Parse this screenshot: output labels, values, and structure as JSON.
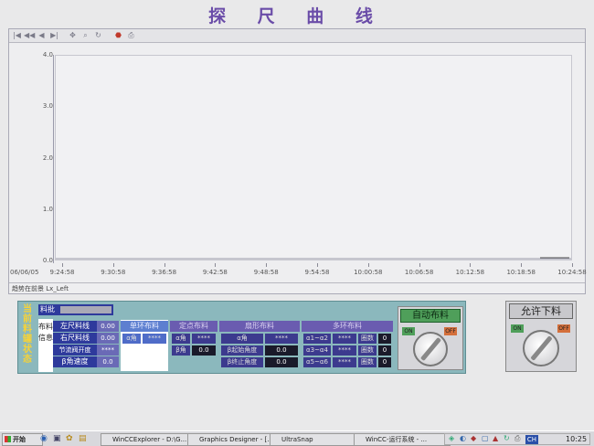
{
  "title": "探 尺 曲 线",
  "trend": {
    "toolbar_icons": [
      "first-icon",
      "prev-icon",
      "back-icon",
      "next-icon",
      "pan-icon",
      "zoom-icon",
      "refresh-icon",
      "stop-icon",
      "print-icon"
    ],
    "status_text": "趋势在前景 Lx_Left",
    "date_label": "06/06/05"
  },
  "chart_data": {
    "type": "line",
    "y_ticks": [
      "4.0",
      "3.0",
      "2.0",
      "1.0",
      "0.0"
    ],
    "ylim": [
      0,
      4
    ],
    "x_ticks": [
      "9:24:58",
      "9:30:58",
      "9:36:58",
      "9:42:58",
      "9:48:58",
      "9:54:58",
      "10:00:58",
      "10:06:58",
      "10:12:58",
      "10:18:58",
      "10:24:58"
    ],
    "series": [
      {
        "x": [],
        "values": []
      }
    ]
  },
  "panel": {
    "vertical_title": "当前料罐状态",
    "feed_label": "料批",
    "info_label": "布料信息",
    "left_ruler": {
      "label": "左尺料线",
      "value": "0.00"
    },
    "right_ruler": {
      "label": "右尺料线",
      "value": "0.00"
    },
    "valve": {
      "label": "节流阀开度",
      "value": "****"
    },
    "beta_speed": {
      "label": "β角速度",
      "value": "0.0"
    },
    "ring": {
      "header": "单环布料",
      "cells": [
        "α角",
        "****"
      ]
    },
    "fixed": {
      "header": "定点布料",
      "cells": [
        "α角",
        "****",
        "β角",
        "0.0"
      ]
    },
    "fan": {
      "header": "扇形布料",
      "cells": [
        "α角",
        "****",
        "β起始角度",
        "0.0",
        "β终止角度",
        "0.0"
      ]
    },
    "multi": {
      "header": "多环布料",
      "rows": [
        [
          "α1~α2",
          "****",
          "圈数",
          "0"
        ],
        [
          "α3~α4",
          "****",
          "圈数",
          "0"
        ],
        [
          "α5~α6",
          "****",
          "圈数",
          "0"
        ]
      ]
    }
  },
  "auto_feed": {
    "title": "自动布料",
    "on": "ON",
    "off": "OFF"
  },
  "allow_discharge": {
    "title": "允许下料",
    "on": "ON",
    "off": "OFF"
  },
  "taskbar": {
    "start": "开始",
    "tasks": [
      "WinCCExplorer - D:\\G...",
      "Graphics Designer - [...",
      "UltraSnap",
      "WinCC-运行系统 - ..."
    ],
    "clock": "10:25",
    "lang": "CH"
  }
}
